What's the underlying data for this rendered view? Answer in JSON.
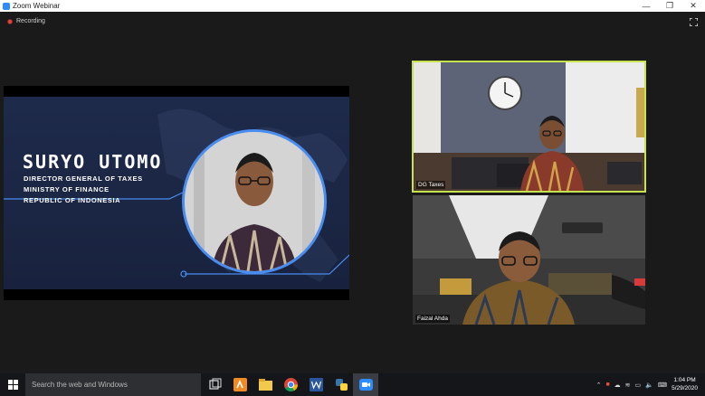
{
  "window": {
    "title": "Zoom Webinar",
    "controls": [
      "—",
      "❐",
      "✕"
    ]
  },
  "recording": {
    "label": "Recording"
  },
  "slide": {
    "name": "SURYO UTOMO",
    "lines": [
      "DIRECTOR GENERAL OF TAXES",
      "MINISTRY OF FINANCE",
      "REPUBLIC OF INDONESIA"
    ]
  },
  "participants": [
    {
      "label": "DG Taxes",
      "active": true
    },
    {
      "label": "Faizal Ahda",
      "active": false
    }
  ],
  "taskbar": {
    "search_placeholder": "Search the web and Windows",
    "apps": [
      "task-view",
      "orange-app",
      "file-explorer",
      "chrome",
      "word",
      "python",
      "zoom"
    ],
    "clock_time": "1:04 PM",
    "clock_date": "5/29/2020"
  },
  "colors": {
    "active_speaker_border": "#c6e34f",
    "slide_accent": "#4a8df0",
    "zoom_blue": "#2d8cff"
  }
}
